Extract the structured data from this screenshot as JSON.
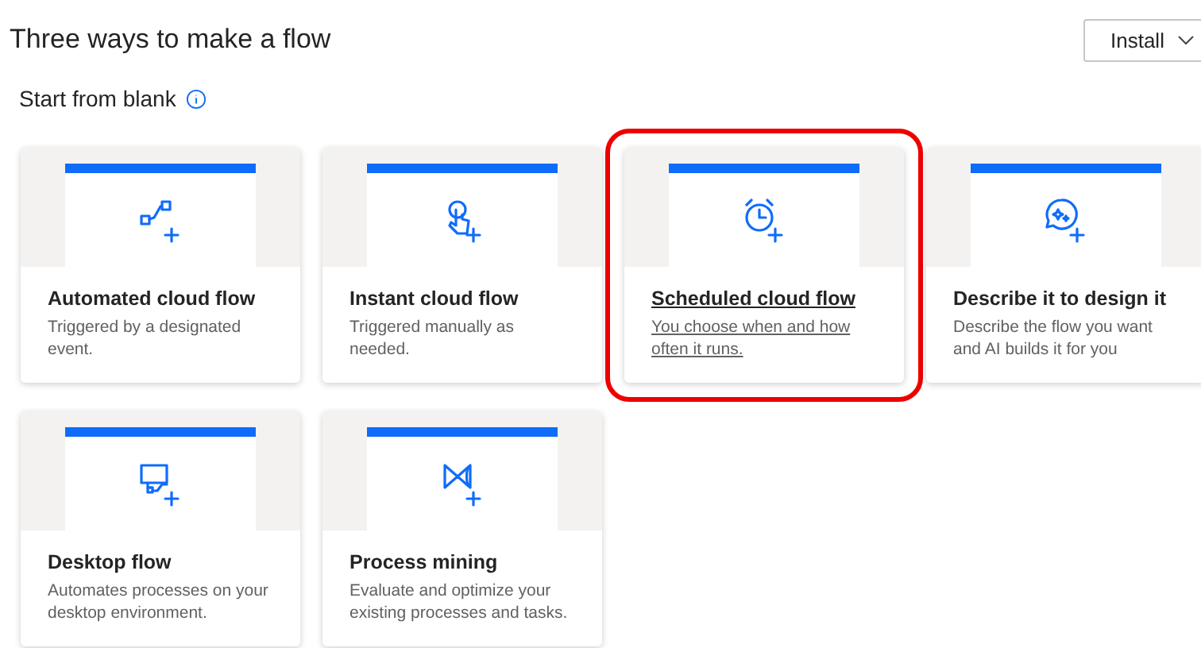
{
  "title": "Three ways to make a flow",
  "install_button": {
    "label": "Install"
  },
  "section": {
    "title": "Start from blank"
  },
  "cards": [
    {
      "kind": "automated",
      "title": "Automated cloud flow",
      "description": "Triggered by a designated event.",
      "selected": false
    },
    {
      "kind": "instant",
      "title": "Instant cloud flow",
      "description": "Triggered manually as needed.",
      "selected": false
    },
    {
      "kind": "scheduled",
      "title": "Scheduled cloud flow",
      "description": "You choose when and how often it runs.",
      "selected": true
    },
    {
      "kind": "describe",
      "title": "Describe it to design it",
      "description": "Describe the flow you want and AI builds it for you",
      "selected": false
    },
    {
      "kind": "desktop",
      "title": "Desktop flow",
      "description": "Automates processes on your desktop environment.",
      "selected": false
    },
    {
      "kind": "process",
      "title": "Process mining",
      "description": "Evaluate and optimize your existing processes and tasks.",
      "selected": false
    }
  ]
}
